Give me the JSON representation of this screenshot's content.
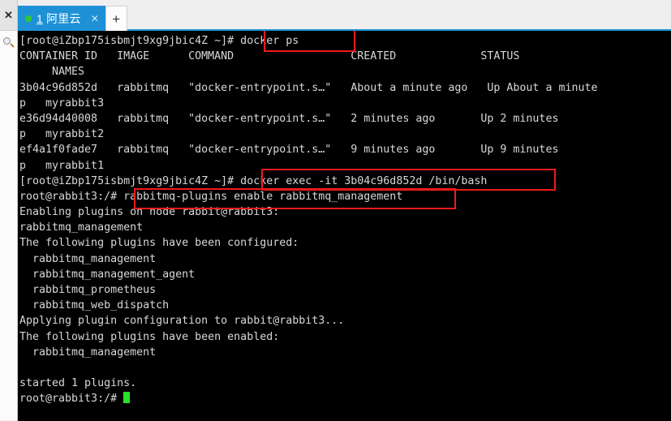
{
  "window": {
    "rail": {
      "close_icon": "close-icon",
      "search_icon": "search-icon",
      "close_glyph": "✕"
    },
    "tabbar": {
      "tab": {
        "number": "1",
        "title": "阿里云",
        "close_glyph": "✕",
        "status_dot_color": "#2fc82f",
        "active_color": "#1e91d6"
      },
      "new_tab_glyph": "+"
    }
  },
  "terminal": {
    "prompt_host": "[root@iZbp175isbmjt9xg9jbic4Z ~]#",
    "prompt_container": "root@rabbit3:/#",
    "cursor_color": "#28e028",
    "background": "#000000",
    "foreground": "#d8d8d8",
    "lines": [
      "[root@iZbp175isbmjt9xg9jbic4Z ~]# docker ps",
      "CONTAINER ID   IMAGE      COMMAND                  CREATED             STATUS",
      "     NAMES",
      "3b04c96d852d   rabbitmq   \"docker-entrypoint.s…\"   About a minute ago   Up About a minute",
      "p   myrabbit3",
      "e36d94d40008   rabbitmq   \"docker-entrypoint.s…\"   2 minutes ago       Up 2 minutes",
      "p   myrabbit2",
      "ef4a1f0fade7   rabbitmq   \"docker-entrypoint.s…\"   9 minutes ago       Up 9 minutes",
      "p   myrabbit1",
      "[root@iZbp175isbmjt9xg9jbic4Z ~]# docker exec -it 3b04c96d852d /bin/bash",
      "root@rabbit3:/# rabbitmq-plugins enable rabbitmq_management",
      "Enabling plugins on node rabbit@rabbit3:",
      "rabbitmq_management",
      "The following plugins have been configured:",
      "  rabbitmq_management",
      "  rabbitmq_management_agent",
      "  rabbitmq_prometheus",
      "  rabbitmq_web_dispatch",
      "Applying plugin configuration to rabbit@rabbit3...",
      "The following plugins have been enabled:",
      "  rabbitmq_management",
      "",
      "started 1 plugins."
    ],
    "final_prompt": "root@rabbit3:/# ",
    "commands": [
      "docker ps",
      "docker exec -it 3b04c96d852d /bin/bash",
      "rabbitmq-plugins enable rabbitmq_management"
    ],
    "containers": [
      {
        "id": "3b04c96d852d",
        "image": "rabbitmq",
        "command": "\"docker-entrypoint.s…\"",
        "created": "About a minute ago",
        "status": "Up About a minute",
        "name": "myrabbit3"
      },
      {
        "id": "e36d94d40008",
        "image": "rabbitmq",
        "command": "\"docker-entrypoint.s…\"",
        "created": "2 minutes ago",
        "status": "Up 2 minutes",
        "name": "myrabbit2"
      },
      {
        "id": "ef4a1f0fade7",
        "image": "rabbitmq",
        "command": "\"docker-entrypoint.s…\"",
        "created": "9 minutes ago",
        "status": "Up 9 minutes",
        "name": "myrabbit1"
      }
    ],
    "annotation_color": "#ef1a1a"
  }
}
